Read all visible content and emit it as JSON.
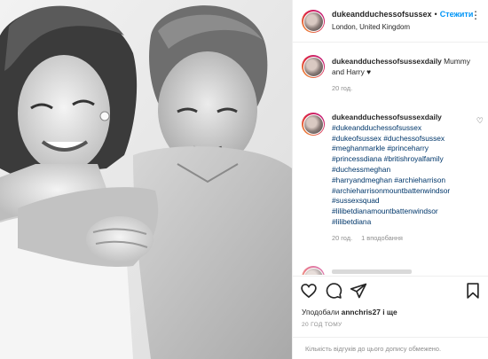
{
  "post": {
    "author": "dukeandduchessofsussex",
    "separator": "•",
    "follow_label": "Стежити",
    "location": "London, United Kingdom",
    "more_glyph": "⋮"
  },
  "comments": [
    {
      "user": "dukeandduchessofsussexdaily",
      "text": "Mummy and Harry ♥",
      "time": "20 год."
    },
    {
      "user": "dukeandduchessofsussexdaily",
      "hashtags": [
        "#dukeandduchessofsussex",
        "#dukeofsussex #duchessofsussex",
        "#meghanmarkle #princeharry",
        "#princessdiana #britishroyalfamily",
        "#duchessmeghan",
        "#harryandmeghan #archieharrison",
        "#archieharrisonmountbattenwindsor",
        "#sussexsquad",
        "#lilibetdianamountbattenwindsor",
        "#lilibetdiana"
      ],
      "time": "20 год.",
      "likes": "1 вподобання"
    }
  ],
  "likes": {
    "prefix": "Уподобали",
    "user": "annchris27",
    "suffix": "і ще"
  },
  "time_ago": "20 ГОД ТОМУ",
  "footer_text": "Кількість відгуків до цього допису обмежено.",
  "icons": [
    "heart-icon",
    "comment-icon",
    "share-icon",
    "bookmark-icon",
    "more-options-icon"
  ],
  "colors": {
    "link": "#0095f6",
    "hashtag": "#00376b",
    "muted": "#8e8e8e",
    "border": "#efefef"
  }
}
